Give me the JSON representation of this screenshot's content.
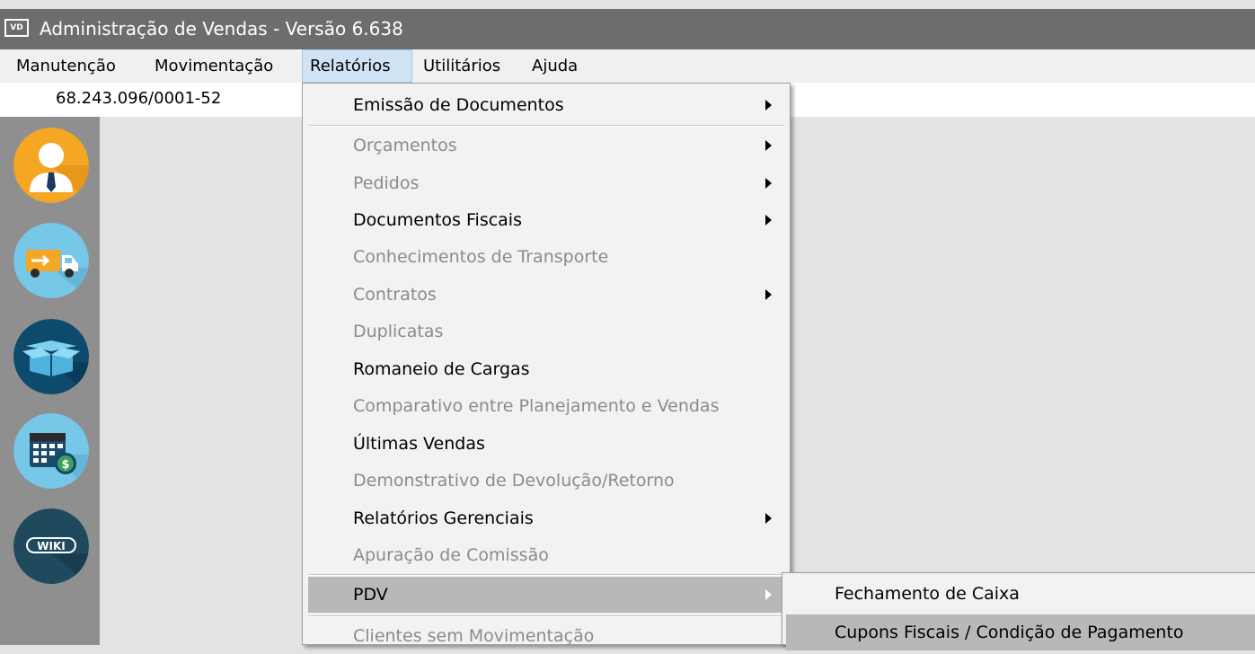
{
  "window": {
    "app_icon_text": "VD",
    "title": "Administração de Vendas - Versão 6.638"
  },
  "menubar": {
    "items": [
      {
        "label": "Manutenção"
      },
      {
        "label": "Movimentação"
      },
      {
        "label": "Relatórios",
        "open": true
      },
      {
        "label": "Utilitários"
      },
      {
        "label": "Ajuda"
      }
    ]
  },
  "infobar": {
    "cnpj": "68.243.096/0001-52"
  },
  "sidebar": {
    "buttons": [
      {
        "icon": "user-icon",
        "color": "#f5a623"
      },
      {
        "icon": "delivery-truck-icon",
        "color": "#76c7e8"
      },
      {
        "icon": "open-box-icon",
        "color": "#0d4a6b"
      },
      {
        "icon": "calendar-money-icon",
        "color": "#76c7e8"
      },
      {
        "icon": "wiki-icon",
        "color": "#1f4a5e",
        "text": "WIKI"
      }
    ]
  },
  "relatorios_menu": {
    "items": [
      {
        "label": "Emissão de Documentos",
        "enabled": true,
        "submenu": true
      },
      {
        "label": "Orçamentos",
        "enabled": false,
        "submenu": true
      },
      {
        "label": "Pedidos",
        "enabled": false,
        "submenu": true
      },
      {
        "label": "Documentos Fiscais",
        "enabled": true,
        "submenu": true
      },
      {
        "label": "Conhecimentos de Transporte",
        "enabled": false,
        "submenu": false
      },
      {
        "label": "Contratos",
        "enabled": false,
        "submenu": true
      },
      {
        "label": "Duplicatas",
        "enabled": false,
        "submenu": false
      },
      {
        "label": "Romaneio de Cargas",
        "enabled": true,
        "submenu": false
      },
      {
        "label": "Comparativo entre Planejamento e Vendas",
        "enabled": false,
        "submenu": false
      },
      {
        "label": "Últimas Vendas",
        "enabled": true,
        "submenu": false
      },
      {
        "label": "Demonstrativo de Devolução/Retorno",
        "enabled": false,
        "submenu": false
      },
      {
        "label": "Relatórios Gerenciais",
        "enabled": true,
        "submenu": true
      },
      {
        "label": "Apuração de Comissão",
        "enabled": false,
        "submenu": false
      },
      {
        "label": "PDV",
        "enabled": true,
        "submenu": true,
        "highlighted": true
      },
      {
        "label": "Clientes sem Movimentação",
        "enabled": false,
        "submenu": false
      }
    ]
  },
  "pdv_submenu": {
    "items": [
      {
        "label": "Fechamento de Caixa"
      },
      {
        "label": "Cupons Fiscais / Condição de Pagamento",
        "highlighted": true
      }
    ]
  },
  "colors": {
    "title_bar": "#6d6d6d",
    "menu_background": "#f2f2f2",
    "highlight": "#b8b8b8",
    "disabled_text": "#8b8b8b",
    "sidebar": "#8f8f8f",
    "desktop": "#e3e3e3"
  }
}
